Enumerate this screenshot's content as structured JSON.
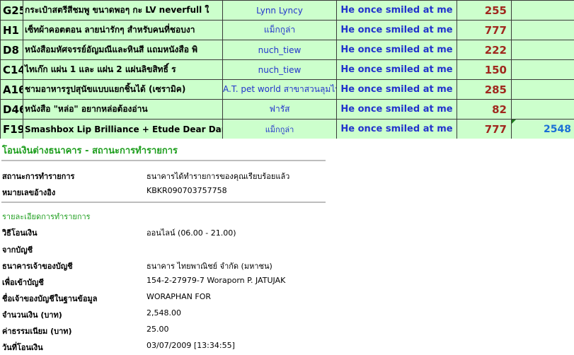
{
  "sheet": {
    "rows": [
      {
        "code": "G25",
        "item": "กระเป๋าสตรีสีชมพู ขนาดพอๆ กะ LV neverfull ใ",
        "seller": "Lynn Lyncy",
        "note": "He once smiled at me",
        "price": "255",
        "total": ""
      },
      {
        "code": "H1",
        "item": "เซ็ทผ้าคอตตอน ลายน่ารักๆ สำหรับคนที่ชอบงา",
        "seller": "แม็กกูล่า",
        "note": "He once smiled at me",
        "price": "777",
        "total": ""
      },
      {
        "code": "D8",
        "item": "หนังสือมหัศจรรย์อัญมณีและหินสี แถมหนังสือ พิ",
        "seller": "nuch_tiew",
        "note": "He once smiled at me",
        "price": "222",
        "total": ""
      },
      {
        "code": "C14",
        "item": "ไทเก๊ก แผ่น 1 และ แผ่น 2 แผ่นลิขสิทธิ์ ร",
        "seller": "nuch_tiew",
        "note": "He once smiled at me",
        "price": "150",
        "total": ""
      },
      {
        "code": "A16",
        "item": "ชามอาหารรูปสุนัขแบบแยกชิ้นได้ (เซรามิค)",
        "seller": "A.T. pet world สาขาสวนลุมไน",
        "note": "He once smiled at me",
        "price": "285",
        "total": ""
      },
      {
        "code": "D46",
        "item": "หนังสือ \"หล่อ\" อยากหล่อต้องอ่าน",
        "seller": "ฟารัส",
        "note": "He once smiled at me",
        "price": "82",
        "total": ""
      },
      {
        "code": "F19",
        "item": "Smashbox Lip Brilliance +  Etude Dear Dar",
        "seller": "แม็กกูล่า",
        "note": "He once smiled at me",
        "price": "777",
        "total": "2548"
      }
    ]
  },
  "receipt": {
    "title": "โอนเงินต่างธนาคาร - สถานะการทำรายการ",
    "status_label": "สถานะการทำรายการ",
    "status_value": "ธนาคารได้ทำรายการของคุณเรียบร้อยแล้ว",
    "ref_label": "หมายเลขอ้างอิง",
    "ref_value": "KBKR090703757758",
    "details_heading": "รายละเอียดการทำรายการ",
    "method_label": "วิธีโอนเงิน",
    "method_value": "ออนไลน์ (06.00 - 21.00)",
    "from_label": "จากบัญชี",
    "from_value": "",
    "bank_label": "ธนาคารเจ้าของบัญชี",
    "bank_value": "ธนาคาร ไทยพาณิชย์ จำกัด (มหาชน)",
    "to_label": "เพื่อเข้าบัญชี",
    "to_value": "154-2-27979-7 Woraporn P. JATUJAK",
    "owner_label": "ชื่อเจ้าของบัญชีในฐานข้อมูล",
    "owner_value": "WORAPHAN FOR",
    "amount_label": "จำนวนเงิน (บาท)",
    "amount_value": "2,548.00",
    "fee_label": "ค่าธรรมเนียม (บาท)",
    "fee_value": "25.00",
    "date_label": "วันที่โอนเงิน",
    "date_value": "03/07/2009 [13:34:55]"
  }
}
